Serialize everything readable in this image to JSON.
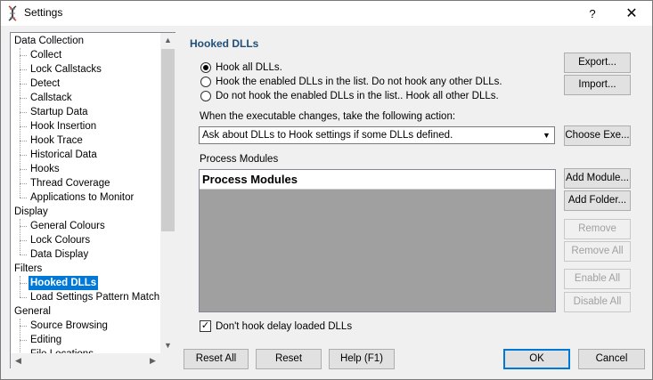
{
  "window": {
    "title": "Settings",
    "help_label": "?",
    "close_label": "✕"
  },
  "tree": {
    "items": [
      {
        "label": "Data Collection",
        "level": 0
      },
      {
        "label": "Collect",
        "level": 1
      },
      {
        "label": "Lock Callstacks",
        "level": 1
      },
      {
        "label": "Detect",
        "level": 1
      },
      {
        "label": "Callstack",
        "level": 1
      },
      {
        "label": "Startup Data",
        "level": 1
      },
      {
        "label": "Hook Insertion",
        "level": 1
      },
      {
        "label": "Hook Trace",
        "level": 1
      },
      {
        "label": "Historical Data",
        "level": 1
      },
      {
        "label": "Hooks",
        "level": 1
      },
      {
        "label": "Thread Coverage",
        "level": 1
      },
      {
        "label": "Applications to Monitor",
        "level": 1
      },
      {
        "label": "Display",
        "level": 0
      },
      {
        "label": "General Colours",
        "level": 1
      },
      {
        "label": "Lock Colours",
        "level": 1
      },
      {
        "label": "Data Display",
        "level": 1
      },
      {
        "label": "Filters",
        "level": 0
      },
      {
        "label": "Hooked DLLs",
        "level": 1,
        "selected": true
      },
      {
        "label": "Load Settings Pattern Match",
        "level": 1
      },
      {
        "label": "General",
        "level": 0
      },
      {
        "label": "Source Browsing",
        "level": 1
      },
      {
        "label": "Editing",
        "level": 1
      },
      {
        "label": "File Locations",
        "level": 1
      }
    ]
  },
  "panel": {
    "title": "Hooked DLLs",
    "radios": [
      {
        "label": "Hook all DLLs.",
        "checked": true
      },
      {
        "label": "Hook the enabled DLLs in the list. Do not hook any other DLLs.",
        "checked": false
      },
      {
        "label": "Do not hook the enabled DLLs in the list.. Hook all other DLLs.",
        "checked": false
      }
    ],
    "export_label": "Export...",
    "import_label": "Import...",
    "exe_change_label": "When the executable changes, take the following action:",
    "exe_change_value": "Ask about DLLs to Hook settings if some DLLs defined.",
    "choose_exe_label": "Choose Exe...",
    "modules_label": "Process Modules",
    "modules_header": "Process Modules",
    "add_module_label": "Add Module...",
    "add_folder_label": "Add Folder...",
    "remove_label": "Remove",
    "remove_all_label": "Remove All",
    "enable_all_label": "Enable All",
    "disable_all_label": "Disable All",
    "delay_checkbox_label": "Don't hook delay loaded DLLs",
    "delay_checked": true
  },
  "footer": {
    "reset_all_label": "Reset All",
    "reset_label": "Reset",
    "help_label": "Help (F1)",
    "ok_label": "OK",
    "cancel_label": "Cancel"
  }
}
